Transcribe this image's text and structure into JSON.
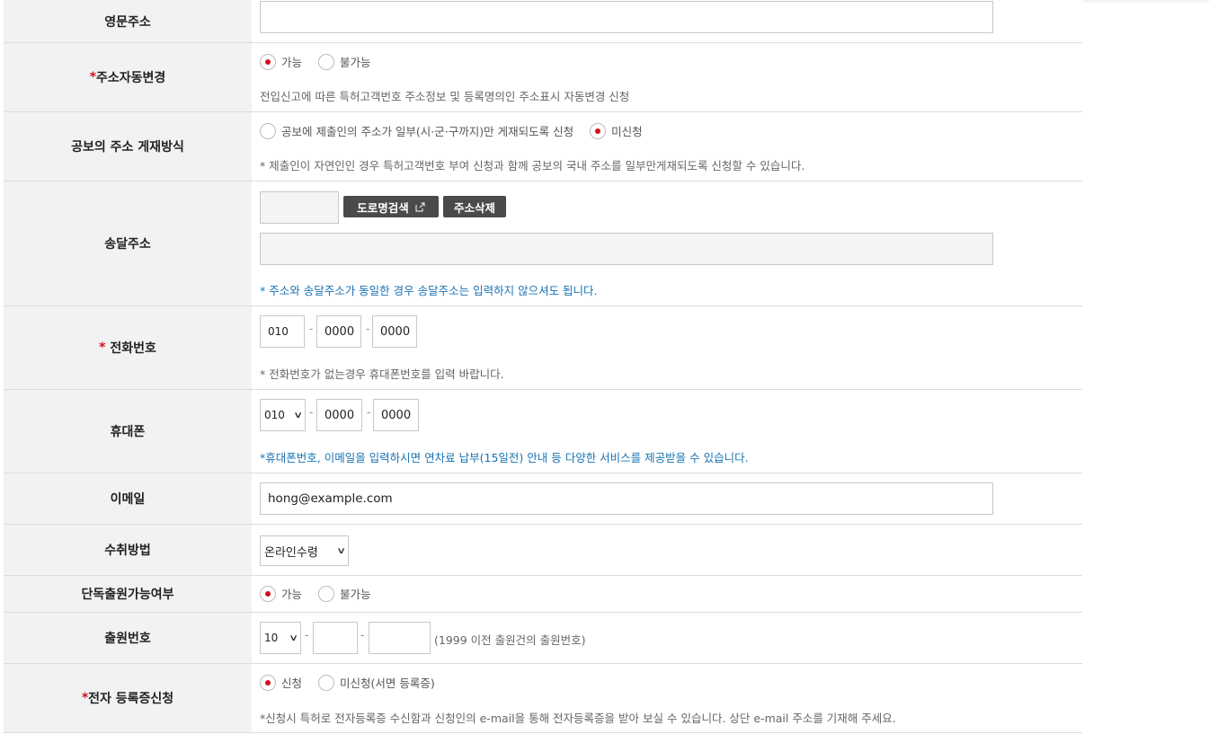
{
  "english_address": {
    "label": "영문주소",
    "value": ""
  },
  "auto_address_change": {
    "label": "주소자동변경",
    "required_mark": "*",
    "options": [
      "가능",
      "불가능"
    ],
    "selected": 0,
    "note": "전입신고에 따른 특허고객번호 주소정보 및 등록명의인 주소표시 자동변경 신청"
  },
  "gazette_address": {
    "label": "공보의 주소 게재방식",
    "options": [
      "공보에 제출인의 주소가 일부(시·군·구까지)만 게재되도록 신청",
      "미신청"
    ],
    "selected": 1,
    "note": "* 제출인이 자연인인 경우 특허고객번호 부여 신청과 함께 공보의 국내 주소를 일부만게재되도록 신청할 수 있습니다."
  },
  "delivery_address": {
    "label": "송달주소",
    "search_button": "도로명검색",
    "delete_button": "주소삭제",
    "note": "* 주소와 송달주소가 동일한 경우 송달주소는 입력하지 않으셔도 됩니다."
  },
  "phone": {
    "label": "전화번호",
    "required_mark": "*",
    "part1": "010",
    "part2": "0000",
    "part3": "0000",
    "separator": "-",
    "note": "* 전화번호가 없는경우 휴대폰번호를 입력 바랍니다."
  },
  "mobile": {
    "label": "휴대폰",
    "carrier_select": "010",
    "part2": "0000",
    "part3": "0000",
    "separator": "-",
    "note": "*휴대폰번호, 이메일을 입력하시면 연차료 납부(15일전) 안내 등 다양한 서비스를 제공받을 수 있습니다."
  },
  "email": {
    "label": "이메일",
    "value": "hong@example.com"
  },
  "receipt_method": {
    "label": "수취방법",
    "selected": "온라인수령"
  },
  "sole_application": {
    "label": "단독출원가능여부",
    "options": [
      "가능",
      "불가능"
    ],
    "selected": 0
  },
  "application_number": {
    "label": "출원번호",
    "prefix_select": "10",
    "separator": "-",
    "note": "(1999 이전 출원건의 출원번호)"
  },
  "e_certificate": {
    "label": "전자 등록증신청",
    "required_mark": "*",
    "options": [
      "신청",
      "미신청(서면 등록증)"
    ],
    "selected": 0,
    "note": "*신청시 특허로 전자등록증 수신함과 신청인의 e-mail을 통해 전자등록증을 받아 보실 수 있습니다. 상단 e-mail 주소를 기재해 주세요."
  }
}
